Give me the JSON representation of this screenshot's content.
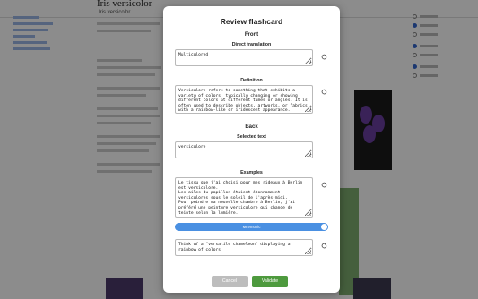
{
  "modal": {
    "title": "Review flashcard",
    "front_heading": "Front",
    "back_heading": "Back",
    "direct_translation_label": "Direct translation",
    "direct_translation_value": "Multicolored",
    "definition_label": "Definition",
    "definition_value": "Versicolore refers to something that exhibits a variety of colors, typically changing or showing different colors at different times or angles. It is often used to describe objects, artworks, or fabrics with a rainbow-like or iridescent appearance.",
    "selected_text_label": "Selected text",
    "selected_text_value": "versicolore",
    "examples_label": "Examples",
    "examples_value": "Le tissu que j'ai choisi pour mes rideaux à Berlin est versicolore.\nLes ailes du papillon étaient étonnamment versicolores sous le soleil de l'après-midi.\nPour peindre ma nouvelle chambre à Berlin, j'ai préféré une peinture versicolore qui change de teinte selon la lumière.",
    "mnemonic_toggle_label": "Mnemonic",
    "mnemonic_toggle_on": true,
    "mnemonic_value": "Think of a \"versatile chameleon\" displaying a rainbow of colors",
    "cancel_label": "Cancel",
    "validate_label": "Validate",
    "accent_color": "#4a90e2",
    "validate_color": "#4e9a3e",
    "cancel_color": "#bdbdbd"
  },
  "background": {
    "page_title": "Iris versicolor",
    "page_subtitle": "Iris versicolor"
  }
}
